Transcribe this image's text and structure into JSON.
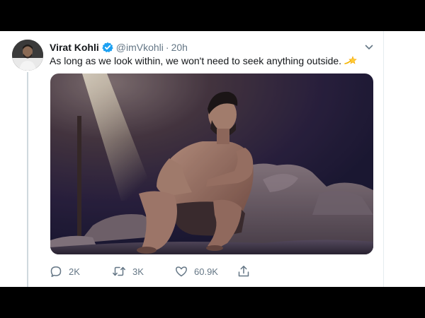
{
  "tweet": {
    "author_name": "Virat Kohli",
    "handle": "@imVkohli",
    "separator": "·",
    "time": "20h",
    "text": "As long as we look within, we won't need to seek anything outside.",
    "verified_icon": "verified-badge-icon",
    "emoji_icon": "sparkle-emoji-icon",
    "more_icon": "chevron-down-icon",
    "media_description_icon": "photo"
  },
  "actions": {
    "reply_count": "2K",
    "retweet_count": "3K",
    "like_count": "60.9K",
    "reply_icon": "reply-icon",
    "retweet_icon": "retweet-icon",
    "like_icon": "heart-icon",
    "share_icon": "share-icon"
  },
  "colors": {
    "accent": "#1da1f2",
    "text_primary": "#14171a",
    "text_secondary": "#657786",
    "letterbox": "#000000"
  }
}
